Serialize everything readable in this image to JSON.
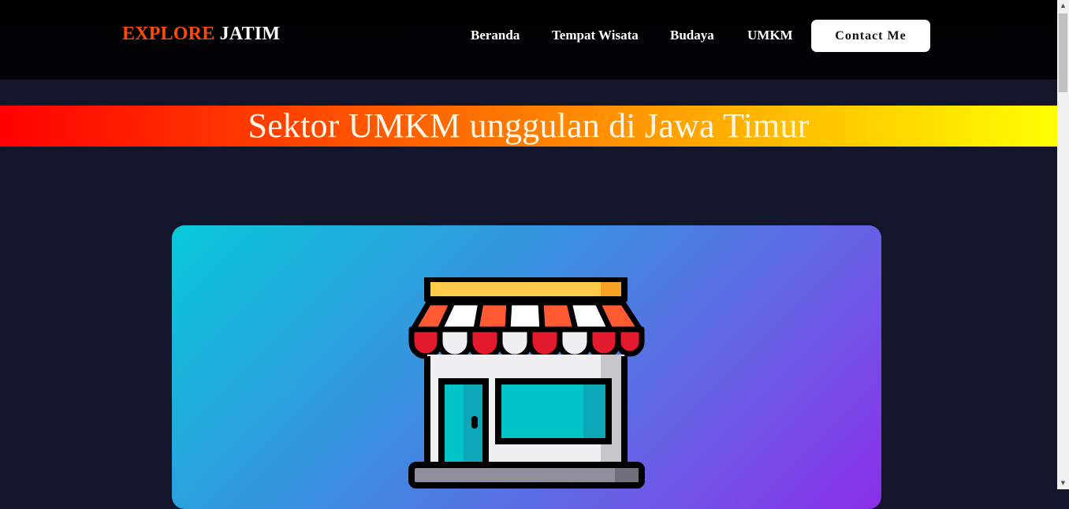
{
  "brand": {
    "part1": "EXPLORE",
    "part2": "JATIM"
  },
  "nav": {
    "items": [
      "Beranda",
      "Tempat Wisata",
      "Budaya",
      "UMKM"
    ],
    "contact_label": "Contact Me"
  },
  "banner": {
    "title": "Sektor UMKM unggulan di Jawa Timur"
  },
  "card": {
    "icon": "store-icon"
  },
  "scrollbar": {
    "up": "▲",
    "down": "▼"
  }
}
